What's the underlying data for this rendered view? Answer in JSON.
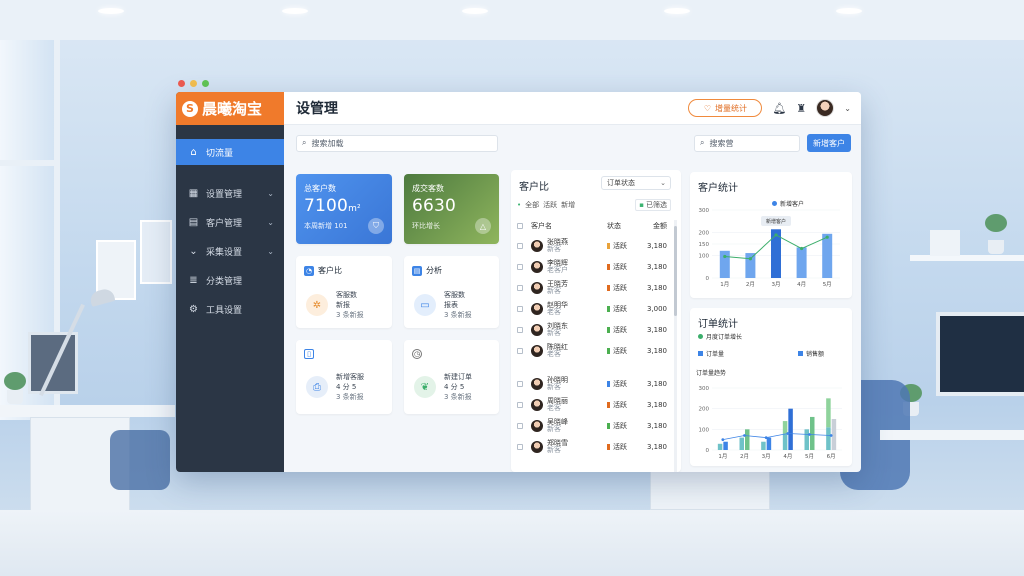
{
  "app": {
    "logo_mark": "S",
    "name": "晨曦淘宝",
    "page_title": "设管理",
    "accent": "#3d84e6",
    "brand": "#f07a2b"
  },
  "topbar": {
    "pill_label": "增量统计",
    "pill_icon": "heart-icon",
    "bell_icon": "bell-icon",
    "avatar_icon": "avatar"
  },
  "sidebar": {
    "items": [
      {
        "label": "切流量",
        "icon": "home-icon"
      },
      {
        "label": "设置管理",
        "icon": "grid-icon"
      },
      {
        "label": "客户管理",
        "icon": "table-icon"
      },
      {
        "label": "采集设置",
        "icon": "chevron-icon"
      },
      {
        "label": "分类管理",
        "icon": "list-icon"
      },
      {
        "label": "工具设置",
        "icon": "gear-icon"
      }
    ]
  },
  "toolbar": {
    "search1": "搜索加载",
    "search2": "搜索营",
    "button": "新增客户"
  },
  "stats": [
    {
      "label": "总客户数",
      "value": "7100",
      "unit": "m²",
      "sub": "本周新增 101"
    },
    {
      "label": "成交客数",
      "value": "6630",
      "unit": "",
      "sub": "环比增长"
    }
  ],
  "mini_cards": [
    {
      "title": "客户比",
      "line1": "客服数",
      "line2": "新报",
      "line3": "3 条新报"
    },
    {
      "title": "分析",
      "line1": "客服数",
      "line2": "报表",
      "line3": "3 条新报"
    },
    {
      "title": "",
      "line1": "新增客服",
      "line2": "4 分 5",
      "line3": "3 条新报"
    },
    {
      "title": "",
      "line1": "新建订单",
      "line2": "4 分 5",
      "line3": "3 条新报"
    }
  ],
  "customers": {
    "title": "客户比",
    "dropdown": "订单状态",
    "filter_tags": [
      "全部",
      "活跃",
      "新增"
    ],
    "filter_button": "已筛选",
    "columns": [
      "客户名",
      "状态",
      "金额"
    ],
    "rows": [
      {
        "name": "张晓燕",
        "sub": "新客",
        "status": "活跃",
        "color": "#e9a33b",
        "value": "3,180"
      },
      {
        "name": "李晓辉",
        "sub": "老客户",
        "status": "活跃",
        "color": "#e06b1f",
        "value": "3,180"
      },
      {
        "name": "王晓芳",
        "sub": "新客",
        "status": "活跃",
        "color": "#e06b1f",
        "value": "3,180"
      },
      {
        "name": "赵明华",
        "sub": "老客",
        "status": "活跃",
        "color": "#4caf50",
        "value": "3,000"
      },
      {
        "name": "刘晓东",
        "sub": "新客",
        "status": "活跃",
        "color": "#4caf50",
        "value": "3,180"
      },
      {
        "name": "陈晓红",
        "sub": "老客",
        "status": "活跃",
        "color": "#4caf50",
        "value": "3,180"
      },
      {
        "name": "孙晓明",
        "sub": "新客",
        "status": "活跃",
        "color": "#3d84e6",
        "value": "3,180"
      },
      {
        "name": "周晓丽",
        "sub": "老客",
        "status": "活跃",
        "color": "#e06b1f",
        "value": "3,180"
      },
      {
        "name": "吴晓峰",
        "sub": "新客",
        "status": "活跃",
        "color": "#4caf50",
        "value": "3,180"
      },
      {
        "name": "郑晓雪",
        "sub": "新客",
        "status": "活跃",
        "color": "#e06b1f",
        "value": "3,180"
      }
    ]
  },
  "chart_data": [
    {
      "type": "bar",
      "title": "客户统计",
      "legend": "新增客户",
      "categories": [
        "1月",
        "2月",
        "3月",
        "4月",
        "5月"
      ],
      "ylim": [
        0,
        300
      ],
      "yticks": [
        0,
        100,
        150,
        200,
        300
      ],
      "series": [
        {
          "name": "新增客户",
          "values": [
            120,
            110,
            215,
            135,
            195
          ]
        }
      ],
      "line": [
        95,
        85,
        190,
        130,
        180
      ],
      "annotation": "新增客户"
    },
    {
      "type": "bar",
      "title": "订单统计",
      "subtitle": "月度订单增长",
      "legend": [
        "订单量",
        "销售额"
      ],
      "section_label": "订单量趋势",
      "categories": [
        "1月",
        "2月",
        "3月",
        "4月",
        "5月",
        "6月"
      ],
      "ylim": [
        0,
        300
      ],
      "yticks": [
        0,
        100,
        200,
        300
      ],
      "series": [
        {
          "name": "订单量",
          "values": [
            40,
            100,
            60,
            200,
            160,
            150
          ]
        },
        {
          "name": "销售额",
          "values": [
            30,
            60,
            40,
            80,
            100,
            110
          ]
        }
      ],
      "extra": [
        0,
        0,
        0,
        60,
        0,
        140
      ],
      "line": [
        50,
        70,
        60,
        80,
        75,
        70
      ]
    }
  ]
}
